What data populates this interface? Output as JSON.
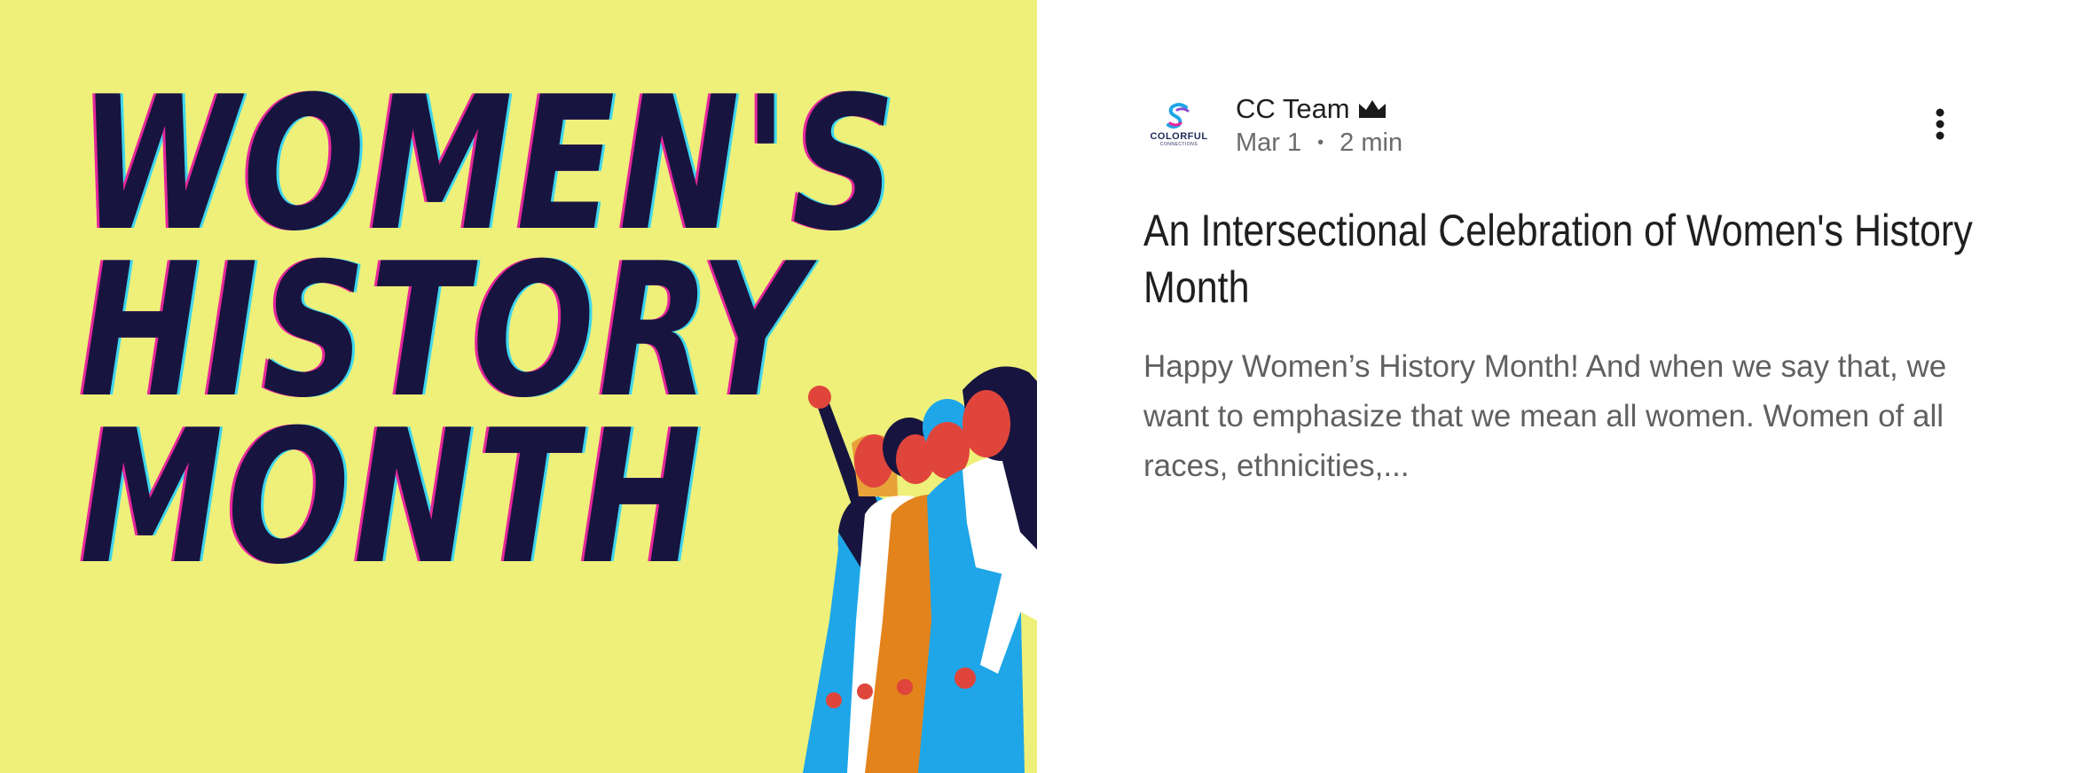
{
  "hero": {
    "title_lines": [
      "WOMEN'S",
      "HISTORY",
      "MONTH"
    ],
    "background_color": "#eef07a",
    "title_color": "#17153f"
  },
  "post": {
    "author": {
      "name": "CC Team",
      "badge_icon": "crown-icon",
      "avatar_text": "COLORFUL",
      "avatar_subtext": "CONNECTIONS"
    },
    "date": "Mar 1",
    "separator": "•",
    "read_time": "2 min",
    "title": "An Intersectional Celebration of Women's History Month",
    "excerpt": "Happy Women’s History Month! And when we say that, we want to emphasize that we mean all women. Women of all races, ethnicities,..."
  },
  "menu_icon": "more-vertical-icon"
}
